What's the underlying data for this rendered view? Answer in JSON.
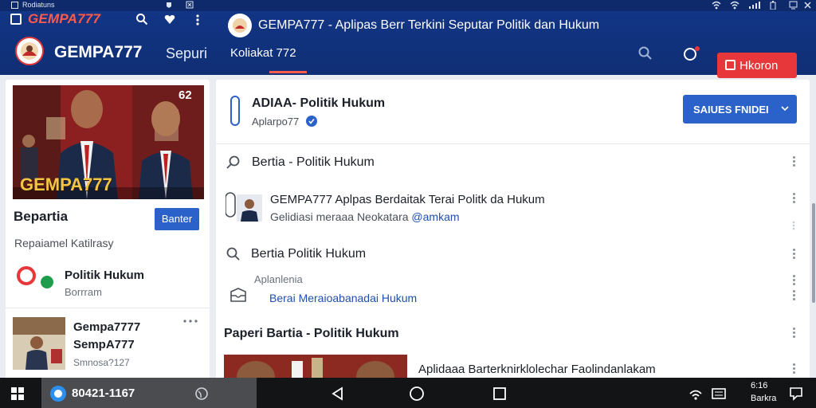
{
  "status_bar": {
    "app_label": "Rodiatuns",
    "brand": "GEMPA777"
  },
  "header": {
    "logo_text": "GEMPA777",
    "section_label": "Sepuri",
    "page_title": "GEMPA777 - Aplipas Berr Terkini Seputar Politik dan Hukum",
    "active_tab": "Koliakat 772",
    "cta_label": "Hkoron"
  },
  "left_panel": {
    "banner_brand": "GEMPA777",
    "banner_badge": "62",
    "section_title": "Bepartia",
    "section_button": "Banter",
    "subtitle": "Repaiamel Katilrasy",
    "item1": {
      "title": "Politik Hukum",
      "subtitle": "Borrram"
    },
    "item2": {
      "title": "Gempa7777",
      "subtitle2": "SempA777",
      "meta": "Smnosa?127"
    }
  },
  "main": {
    "header_title": "ADIAA- Politik Hukum",
    "header_subtitle": "Aplarpo77",
    "header_button": "SAIUES FNIDEI",
    "rows": [
      {
        "title": "Bertia - Politik Hukum"
      },
      {
        "title": "GEMPA777  Aplpas Berdaitak Terai Politk da Hukum",
        "sub_prefix": "Gelidiasi meraaa Neokatara",
        "sub_link": "@amkam"
      },
      {
        "title": "Bertia Politik Hukum"
      },
      {
        "label": "Aplanlenia",
        "link": "Berai Meraioabanadai Hukum"
      }
    ],
    "section_title": "Paperi Bartia - Politik Hukum",
    "featured_caption": "Aplidaaa Barterknirklolechar Faolindanlakam"
  },
  "taskbar": {
    "app_label": "80421-1167",
    "time": "6:16",
    "date": "Barkra"
  },
  "colors": {
    "header_blue": "#123585",
    "accent_red": "#e8373a",
    "button_blue": "#2b62c9",
    "link_blue": "#1f4fae"
  }
}
